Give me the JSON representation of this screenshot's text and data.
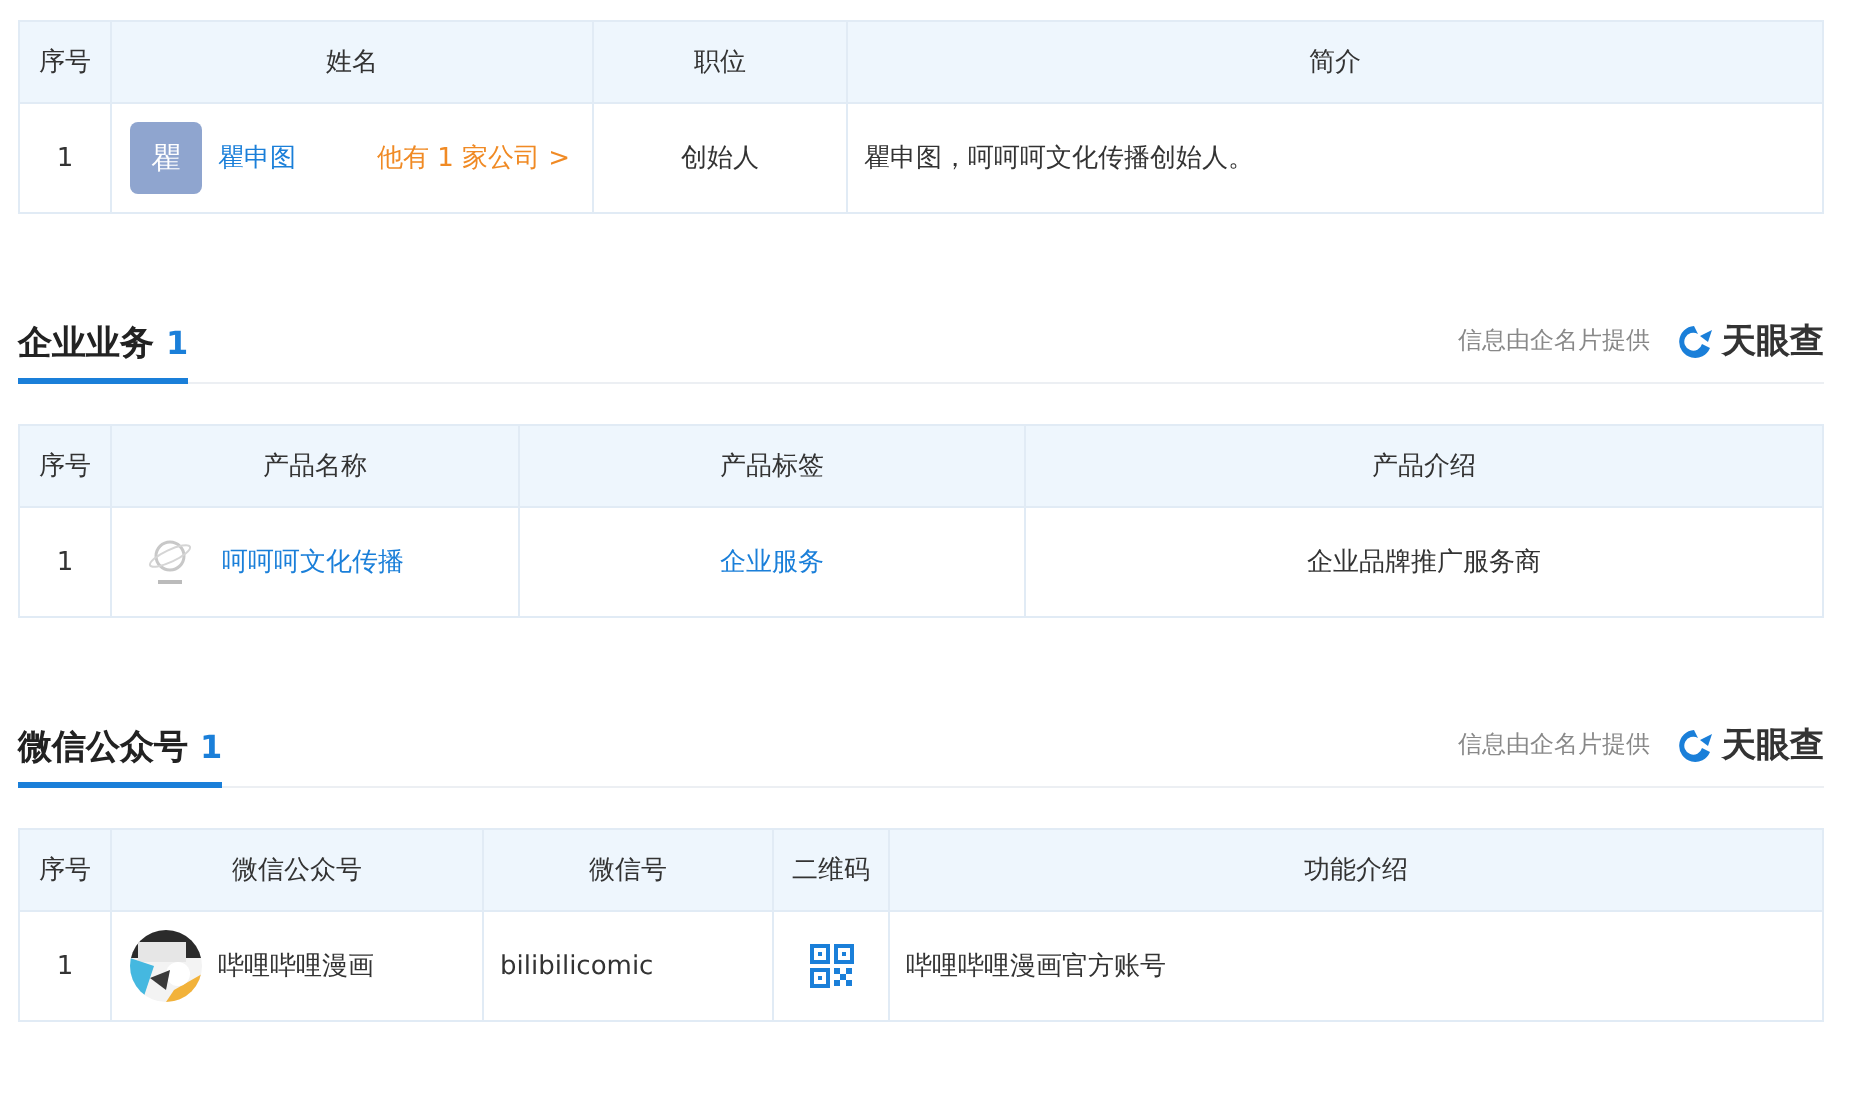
{
  "people_table": {
    "columns": [
      "序号",
      "姓名",
      "职位",
      "简介"
    ],
    "rows": [
      {
        "index": "1",
        "avatar_char": "瞿",
        "name": "瞿申图",
        "companies_link": "他有 1 家公司 >",
        "position": "创始人",
        "intro": "瞿申图，呵呵呵文化传播创始人。"
      }
    ]
  },
  "sections": [
    {
      "title": "企业业务",
      "count": "1",
      "source": "信息由企名片提供",
      "brand": "天眼查",
      "kind": "products",
      "columns": [
        "序号",
        "产品名称",
        "产品标签",
        "产品介绍"
      ],
      "rows": [
        {
          "index": "1",
          "name": "呵呵呵文化传播",
          "tag": "企业服务",
          "intro": "企业品牌推广服务商"
        }
      ]
    },
    {
      "title": "微信公众号",
      "count": "1",
      "source": "信息由企名片提供",
      "brand": "天眼查",
      "kind": "wechat",
      "columns": [
        "序号",
        "微信公众号",
        "微信号",
        "二维码",
        "功能介绍"
      ],
      "rows": [
        {
          "index": "1",
          "name": "哔哩哔哩漫画",
          "account": "bilibilicomic",
          "intro": "哔哩哔哩漫画官方账号"
        }
      ]
    }
  ]
}
